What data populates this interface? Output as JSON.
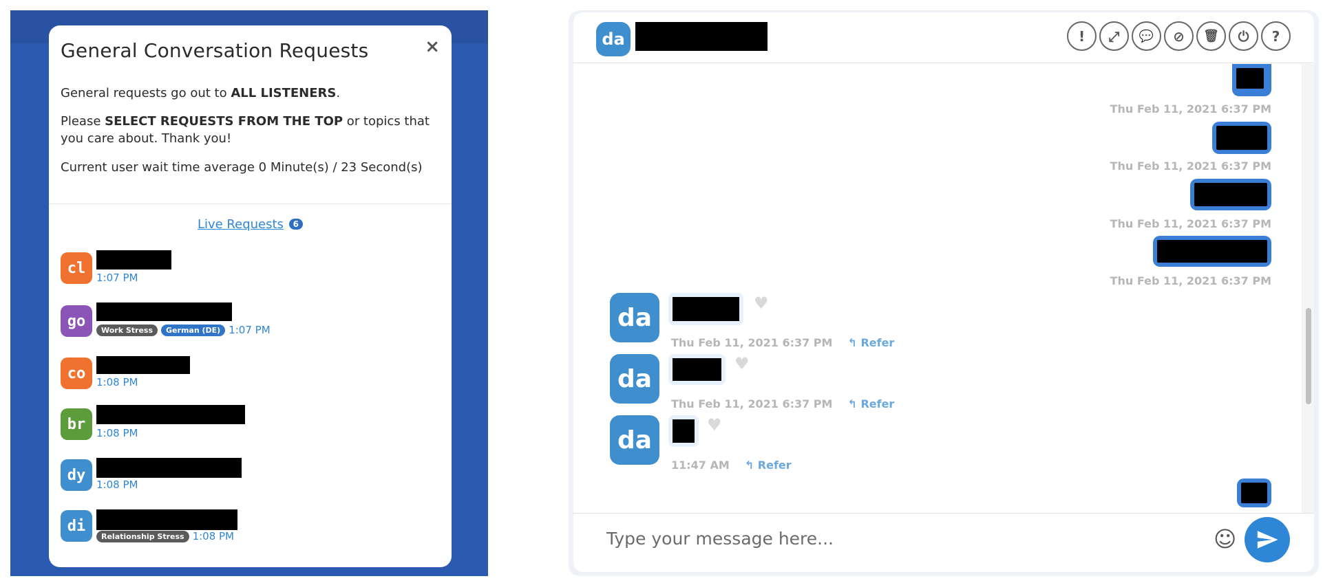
{
  "modal": {
    "title": "General Conversation Requests",
    "close": "×",
    "line1_prefix": "General requests go out to ",
    "line1_bold": "ALL LISTENERS",
    "line1_suffix": ".",
    "line2_prefix": "Please ",
    "line2_bold": "SELECT REQUESTS FROM THE TOP",
    "line2_suffix": " or topics that you care about. Thank you!",
    "wait_time": "Current user wait time average 0 Minute(s) / 23 Second(s)",
    "live_requests_label": "Live Requests",
    "live_requests_count": "6"
  },
  "requests": [
    {
      "initials": "cl",
      "color": "#f0722e",
      "time": "1:07 PM",
      "tags": []
    },
    {
      "initials": "go",
      "color": "#8a55b6",
      "time": "1:07 PM",
      "tags": [
        {
          "label": "Work Stress",
          "color": "#5a5a5a"
        },
        {
          "label": "German (DE)",
          "color": "#2f74c6"
        }
      ]
    },
    {
      "initials": "co",
      "color": "#f0722e",
      "time": "1:08 PM",
      "tags": []
    },
    {
      "initials": "br",
      "color": "#5c9c3a",
      "time": "1:08 PM",
      "tags": []
    },
    {
      "initials": "dy",
      "color": "#3f8fcf",
      "time": "1:08 PM",
      "tags": []
    },
    {
      "initials": "di",
      "color": "#3f8fcf",
      "time": "1:08 PM",
      "tags": [
        {
          "label": "Relationship Stress",
          "color": "#5a5a5a"
        }
      ]
    }
  ],
  "chat": {
    "header_avatar": "da",
    "header_icons": [
      {
        "name": "report-icon",
        "glyph": "!"
      },
      {
        "name": "expand-icon",
        "glyph": "⤢"
      },
      {
        "name": "chat-bubbles-icon",
        "glyph": "💬"
      },
      {
        "name": "block-icon",
        "glyph": "⊘"
      },
      {
        "name": "trash-icon",
        "glyph": "🗑"
      },
      {
        "name": "power-icon",
        "glyph": "⏻"
      },
      {
        "name": "help-icon",
        "glyph": "?"
      }
    ],
    "outgoing_timestamps": [
      "Thu Feb 11, 2021 6:37 PM",
      "Thu Feb 11, 2021 6:37 PM",
      "Thu Feb 11, 2021 6:37 PM",
      "Thu Feb 11, 2021 6:37 PM"
    ],
    "incoming": [
      {
        "avatar": "da",
        "timestamp": "Thu Feb 11, 2021 6:37 PM",
        "refer": "Refer"
      },
      {
        "avatar": "da",
        "timestamp": "Thu Feb 11, 2021 6:37 PM",
        "refer": "Refer"
      },
      {
        "avatar": "da",
        "timestamp": "11:47 AM",
        "refer": "Refer"
      }
    ],
    "composer_placeholder": "Type your message here...",
    "emoji_glyph": "☺"
  }
}
